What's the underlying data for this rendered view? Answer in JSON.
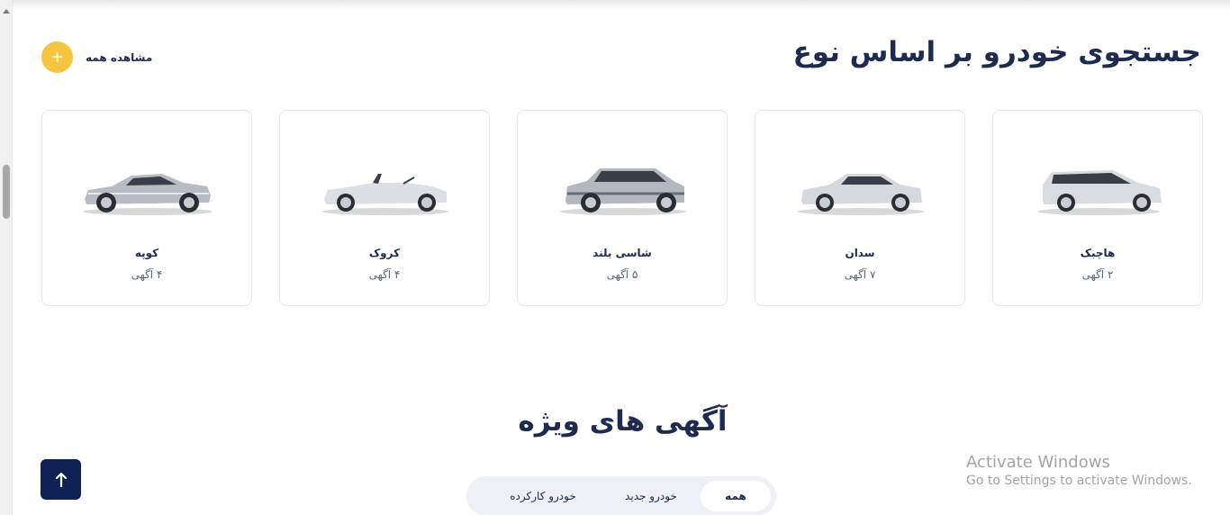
{
  "section": {
    "title": "جستجوی خودرو بر اساس نوع",
    "view_all_label": "مشاهده همه",
    "view_all_icon": "+"
  },
  "body_types": [
    {
      "name": "هاچبک",
      "count": "۲ آگهی",
      "icon": "hatchback-car"
    },
    {
      "name": "سدان",
      "count": "۷ آگهی",
      "icon": "sedan-car"
    },
    {
      "name": "شاسی بلند",
      "count": "۵ آگهی",
      "icon": "suv-car"
    },
    {
      "name": "کروک",
      "count": "۴ آگهی",
      "icon": "convertible-car"
    },
    {
      "name": "کوپه",
      "count": "۴ آگهی",
      "icon": "coupe-car"
    }
  ],
  "featured": {
    "title": "آگهی های ویژه",
    "tabs": [
      {
        "label": "همه",
        "active": true
      },
      {
        "label": "خودرو جدید",
        "active": false
      },
      {
        "label": "خودرو کارکرده",
        "active": false
      }
    ]
  },
  "back_to_top_icon": "arrow-up",
  "watermark": {
    "title": "Activate Windows",
    "subtitle": "Go to Settings to activate Windows."
  },
  "colors": {
    "accent_yellow": "#f5c542",
    "navy": "#0f2154",
    "text_dark": "#1d2b4f"
  }
}
